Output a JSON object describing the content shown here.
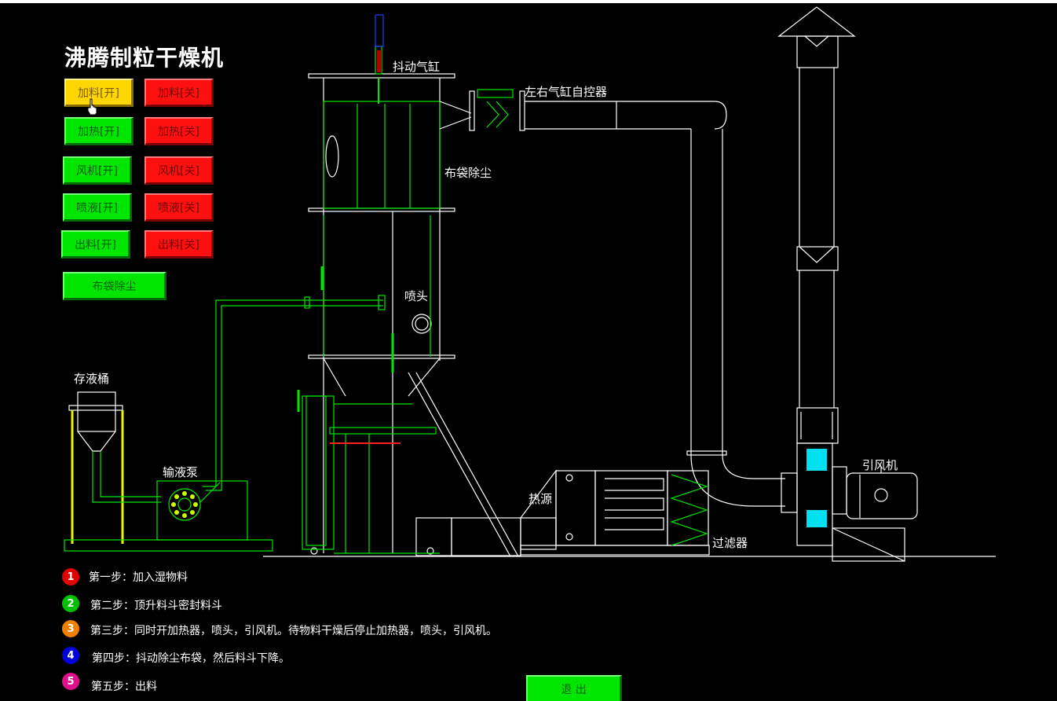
{
  "app": {
    "title": "沸腾制粒干燥机"
  },
  "controls": [
    {
      "on": "加料[开]",
      "off": "加料[关]"
    },
    {
      "on": "加热[开]",
      "off": "加热[关]"
    },
    {
      "on": "风机[开]",
      "off": "风机[关]"
    },
    {
      "on": "喷液[开]",
      "off": "喷液[关]"
    },
    {
      "on": "出料[开]",
      "off": "出料[关]"
    }
  ],
  "dust_button": "布袋除尘",
  "labels": {
    "shake_cylinder": "抖动气缸",
    "lr_cylinder": "左右气缸自控器",
    "bag_filter": "布袋除尘",
    "nozzle": "喷头",
    "liquid_tank": "存液桶",
    "pump": "输液泵",
    "heat_source": "热源",
    "filter": "过滤器",
    "fan": "引风机"
  },
  "steps": [
    {
      "num": "1",
      "text": "第一步：加入湿物料",
      "color": "#e00000"
    },
    {
      "num": "2",
      "text": "第二步：顶升料斗密封料斗",
      "color": "#00c000"
    },
    {
      "num": "3",
      "text": "第三步：同时开加热器，喷头，引风机。待物料干燥后停止加热器，喷头，引风机。",
      "color": "#f08000"
    },
    {
      "num": "4",
      "text": "第四步：抖动除尘布袋，然后料斗下降。",
      "color": "#0000e0"
    },
    {
      "num": "5",
      "text": "第五步：出料",
      "color": "#e0108a"
    }
  ],
  "exit_button": "退 出",
  "colors": {
    "accent_green": "#00e600",
    "accent_red": "#ff1010",
    "accent_yellow": "#ffd700",
    "cyan": "#00ffff"
  }
}
